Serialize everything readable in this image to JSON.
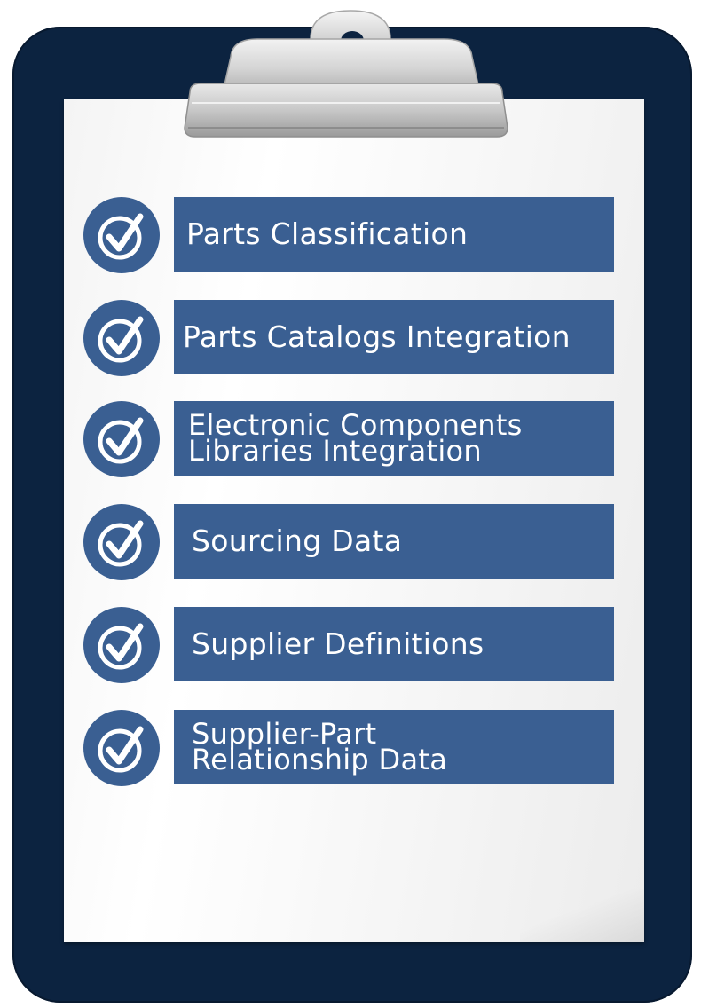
{
  "colors": {
    "board": "#0c2340",
    "label_background": "#3a5f92",
    "check_circle": "#3a5f92",
    "label_text": "#ffffff",
    "paper": "#f7f7f7"
  },
  "icons": {
    "item_marker": "checkmark-circle-icon",
    "clip": "clipboard-clip-icon"
  },
  "checklist": {
    "items": [
      {
        "label": "Parts Classification"
      },
      {
        "label": "Parts Catalogs Integration"
      },
      {
        "label": "Electronic Components\nLibraries Integration"
      },
      {
        "label": "Sourcing Data"
      },
      {
        "label": "Supplier Definitions"
      },
      {
        "label": "Supplier-Part\nRelationship Data"
      }
    ]
  }
}
